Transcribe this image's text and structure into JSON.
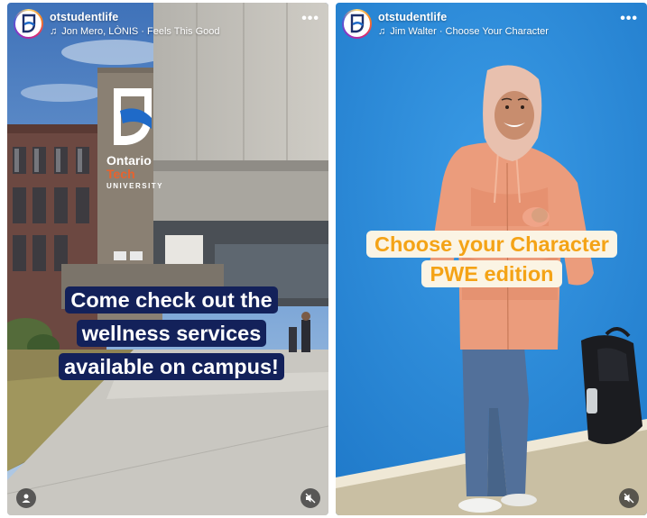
{
  "stories": [
    {
      "username": "otstudentlife",
      "music": "Jon Mero, LÒNIS · Feels This Good",
      "caption_lines": [
        "Come check out the",
        "wellness services",
        "available on campus!"
      ],
      "building_sign": {
        "line1": "Ontario",
        "line2": "Tech",
        "line3": "UNIVERSITY"
      }
    },
    {
      "username": "otstudentlife",
      "music": "Jim Walter · Choose Your Character",
      "caption_lines": [
        "Choose your Character",
        "PWE edition"
      ]
    }
  ],
  "icons": {
    "more": "more-options-icon",
    "music": "music-note-icon",
    "mute": "muted-speaker-icon",
    "tag": "person-tag-icon"
  },
  "colors": {
    "caption1_bg": "#13215a",
    "caption2_text": "#f4a316",
    "caption2_bg": "#fbf4e4",
    "wall_blue": "#2f8fdc",
    "hoodie": "#eb9c7c"
  }
}
